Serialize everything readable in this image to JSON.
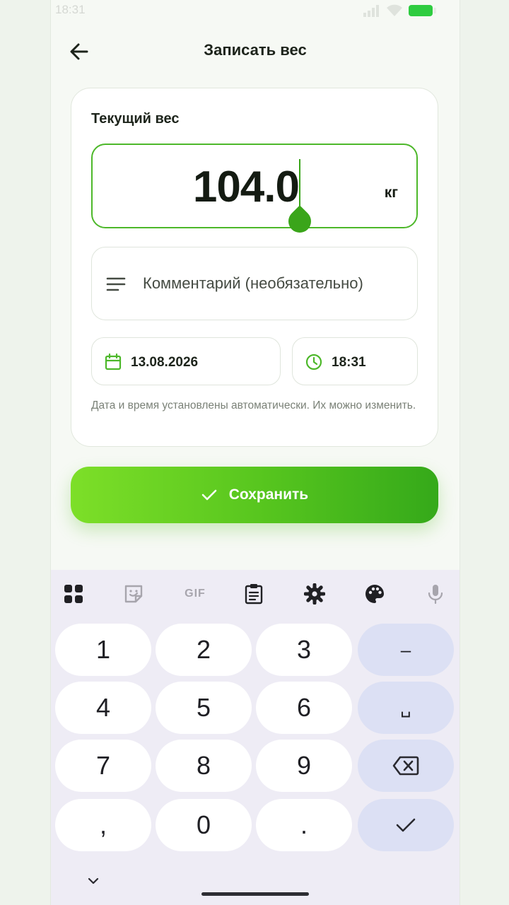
{
  "status_bar": {
    "time": "18:31"
  },
  "header": {
    "title": "Записать вес",
    "back_icon": "arrow-left-icon"
  },
  "card": {
    "label": "Текущий вес",
    "weight_value": "104.0",
    "weight_unit": "кг",
    "comment_placeholder": "Комментарий (необязательно)",
    "date": "13.08.2026",
    "time": "18:31",
    "hint": "Дата и время установлены автоматически. Их можно изменить."
  },
  "save_button": {
    "label": "Сохранить",
    "icon": "check-icon"
  },
  "keyboard": {
    "toolbar": {
      "gif_label": "GIF"
    },
    "keys": {
      "k1": "1",
      "k2": "2",
      "k3": "3",
      "minus": "–",
      "k4": "4",
      "k5": "5",
      "k6": "6",
      "space": "␣",
      "k7": "7",
      "k8": "8",
      "k9": "9",
      "comma": ",",
      "k0": "0",
      "period": "."
    }
  },
  "colors": {
    "accent": "#4db82a",
    "button_start": "#7ddf28",
    "button_end": "#35a91a",
    "background": "#f6f9f4",
    "keyboard_bg": "#eeecf5",
    "function_key": "#dce0f4"
  }
}
